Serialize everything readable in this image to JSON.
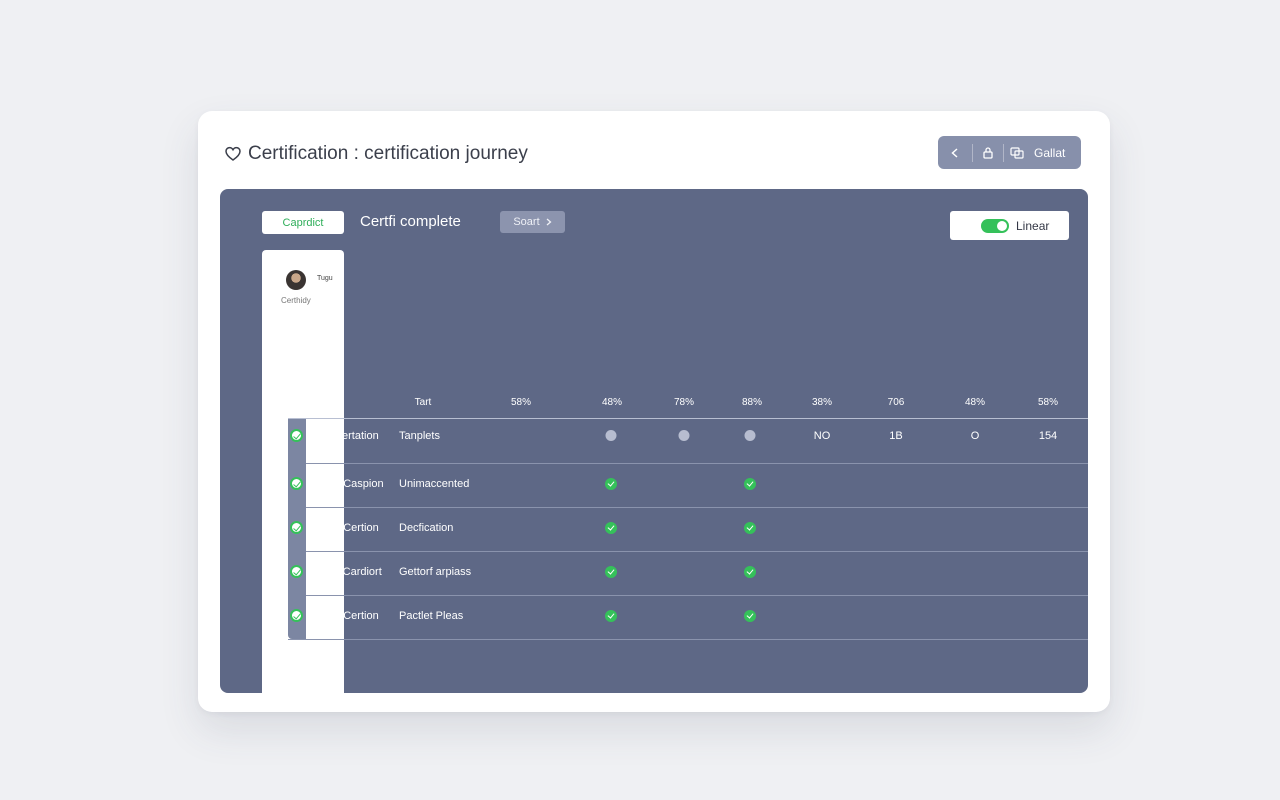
{
  "window": {
    "title": "Certification : certification journey",
    "title_icon": "heart-outline-icon",
    "toolbar": {
      "back_icon": "arrow-left-icon",
      "lock_icon": "lock-icon",
      "copy_icon": "copy-icon",
      "action_label": "Gallat"
    }
  },
  "panel": {
    "active_pill": "Caprdict",
    "heading": "Certfi complete",
    "sort_label": "Soart",
    "toggle_label": "Linear",
    "toggle_on": true,
    "sidebar": {
      "name": "Tugu",
      "subtitle": "Certhidy"
    }
  },
  "table": {
    "headers": [
      "Tart",
      "58%",
      "48%",
      "78%",
      "88%",
      "38%",
      "706",
      "48%",
      "58%"
    ],
    "rows": [
      {
        "name": "CaCertation",
        "desc": "Tanplets",
        "cells": [
          "gray",
          "gray",
          "gray",
          "NO",
          "1B",
          "O",
          "154"
        ]
      },
      {
        "name": "Uad Caspion",
        "desc": "Unimaccented",
        "cells": [
          "green",
          "",
          "green",
          "",
          "",
          "",
          ""
        ]
      },
      {
        "name": "Cad Certion",
        "desc": "Decfication",
        "cells": [
          "green",
          "",
          "green",
          "",
          "",
          "",
          ""
        ]
      },
      {
        "name": "Ped Cardiort",
        "desc": "Gettorf arpiass",
        "cells": [
          "green",
          "",
          "green",
          "",
          "",
          "",
          ""
        ]
      },
      {
        "name": "Ced Certion",
        "desc": "Pactlet Pleas",
        "cells": [
          "green",
          "",
          "green",
          "",
          "",
          "",
          ""
        ]
      }
    ]
  },
  "colors": {
    "panel": "#5e6886",
    "accent_green": "#35c15a",
    "toolbar": "#8790ab"
  }
}
